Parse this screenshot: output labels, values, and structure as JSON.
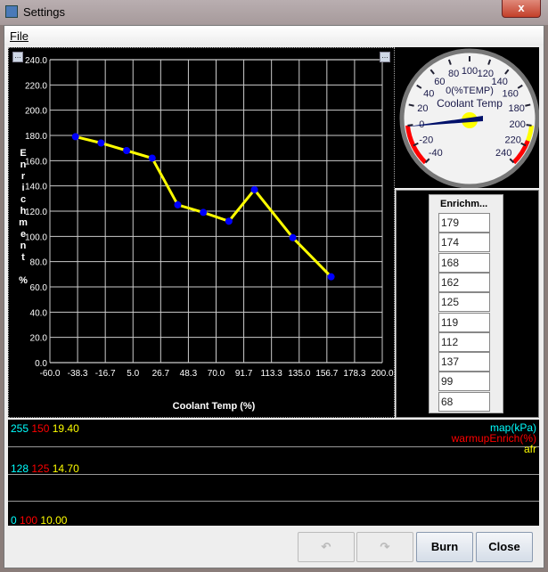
{
  "window": {
    "title": "Settings",
    "close": "x"
  },
  "menu": {
    "file": "File"
  },
  "chart_data": {
    "type": "line",
    "title": "",
    "xlabel": "Coolant Temp (%)",
    "ylabel": "Enrichment %",
    "xlim": [
      -60,
      200
    ],
    "ylim": [
      0,
      240
    ],
    "x_ticks": [
      "-60.0",
      "-38.3",
      "-16.7",
      "5.0",
      "26.7",
      "48.3",
      "70.0",
      "91.7",
      "113.3",
      "135.0",
      "156.7",
      "178.3",
      "200.0"
    ],
    "y_ticks": [
      "0.0",
      "20.0",
      "40.0",
      "60.0",
      "80.0",
      "100.0",
      "120.0",
      "140.0",
      "160.0",
      "180.0",
      "200.0",
      "220.0",
      "240.0"
    ],
    "series": [
      {
        "name": "Enrichment",
        "x": [
          -40,
          -20,
          0,
          20,
          40,
          60,
          80,
          100,
          130,
          160
        ],
        "values": [
          179,
          174,
          168,
          162,
          125,
          119,
          112,
          137,
          99,
          68
        ]
      }
    ],
    "grid": true,
    "line_color": "#ffff00",
    "marker_color": "#0000ff"
  },
  "ylabel_letters": [
    "E",
    "n",
    "r",
    "i",
    "c",
    "h",
    "m",
    "e",
    "n",
    "t",
    "",
    "%"
  ],
  "gauge": {
    "title": "Coolant Temp",
    "units": "0(%TEMP)",
    "min": -40,
    "max": 240,
    "value": -1,
    "labels": [
      "-40",
      "-20",
      "0",
      "20",
      "40",
      "60",
      "80",
      "100",
      "120",
      "140",
      "160",
      "180",
      "200",
      "220",
      "240"
    ]
  },
  "table": {
    "header": "Enrichm...",
    "values": [
      "179",
      "174",
      "168",
      "162",
      "125",
      "119",
      "112",
      "137",
      "99",
      "68"
    ]
  },
  "log": {
    "top": {
      "a": "255",
      "b": "150",
      "c": "19.40"
    },
    "mid": {
      "a": "128",
      "b": "125",
      "c": "14.70"
    },
    "bot": {
      "a": "0",
      "b": "100",
      "c": "10.00"
    },
    "legend": [
      "map(kPa)",
      "warmupEnrich(%)",
      "afr"
    ]
  },
  "buttons": {
    "undo": "↶",
    "redo": "↷",
    "burn": "Burn",
    "close": "Close"
  }
}
